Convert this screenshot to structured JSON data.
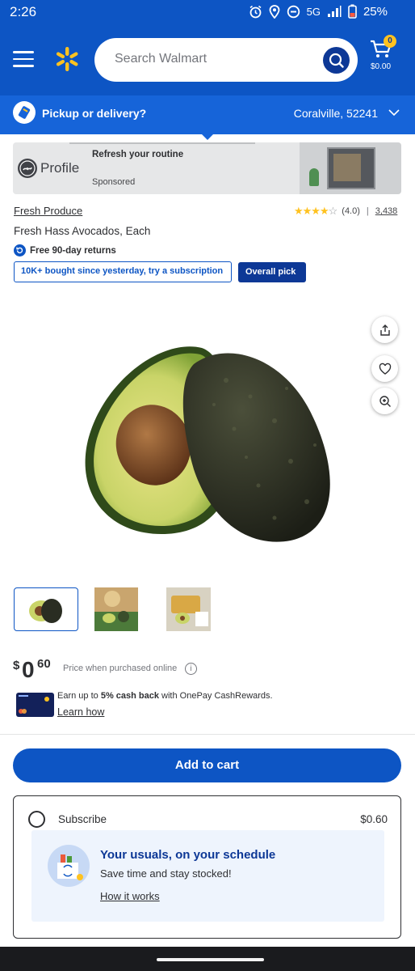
{
  "status_bar": {
    "time": "2:26",
    "network": "5G",
    "battery": "25%"
  },
  "header": {
    "search_placeholder": "Search Walmart",
    "cart_count": "0",
    "cart_total": "$0.00",
    "brand_color": "#0d55c4",
    "spark_color": "#ffc220"
  },
  "pickup": {
    "label": "Pickup or delivery?",
    "location": "Coralville, 52241"
  },
  "ad": {
    "brand": "Profile",
    "headline": "Refresh your routine",
    "sponsored": "Sponsored"
  },
  "product": {
    "brand": "Fresh Produce",
    "title": "Fresh Hass Avocados, Each",
    "rating_text": "(4.0)",
    "rating_value": 4.0,
    "review_count": "3,438",
    "returns": "Free 90-day returns",
    "subscription_tag": "10K+ bought since yesterday, try a subscription",
    "overall_pick": "Overall pick"
  },
  "thumbnails": [
    "avocado-halves-thumbnail",
    "avocado-dish-thumbnail",
    "avocado-toast-thumbnail"
  ],
  "price": {
    "currency": "$",
    "dollars": "0",
    "cents": "60",
    "note": "Price when purchased online"
  },
  "cashback": {
    "prefix": "Earn up to ",
    "highlight": "5% cash back",
    "suffix": " with OnePay CashRewards.",
    "link": "Learn how"
  },
  "actions": {
    "add_to_cart": "Add to cart"
  },
  "subscribe": {
    "label": "Subscribe",
    "price": "$0.60",
    "heading": "Your usuals, on your schedule",
    "description": "Save time and stay stocked!",
    "link": "How it works"
  }
}
